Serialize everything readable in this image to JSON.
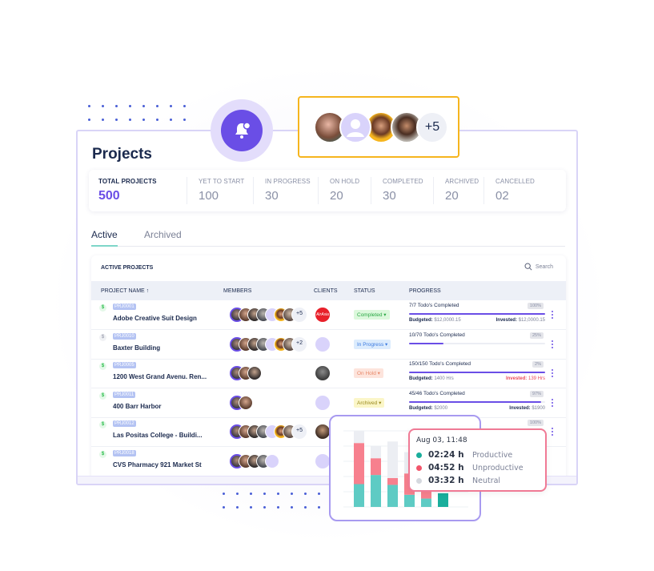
{
  "page": {
    "title": "Projects"
  },
  "stats": [
    {
      "label": "TOTAL PROJECTS",
      "value": "500"
    },
    {
      "label": "YET TO START",
      "value": "100"
    },
    {
      "label": "IN PROGRESS",
      "value": "30"
    },
    {
      "label": "ON HOLD",
      "value": "20"
    },
    {
      "label": "COMPLETED",
      "value": "30"
    },
    {
      "label": "ARCHIVED",
      "value": "20"
    },
    {
      "label": "CANCELLED",
      "value": "02"
    }
  ],
  "tabs": [
    {
      "label": "Active",
      "active": true
    },
    {
      "label": "Archived",
      "active": false
    }
  ],
  "table": {
    "title": "ACTIVE PROJECTS",
    "search_label": "Search",
    "columns": [
      "PROJECT NAME ↑",
      "MEMBERS",
      "CLIENTS",
      "STATUS",
      "PROGRESS"
    ],
    "rows": [
      {
        "id": "PRJ0001",
        "name": "Adobe Creative Suit Design",
        "billing": "paid",
        "members_extra": "+5",
        "member_count": 7,
        "client": "AirAsia",
        "client_type": "airasia",
        "status": "Completed",
        "status_type": "completed",
        "todos": "7/7 Todo's Completed",
        "percent": "100%",
        "progress": 1.0,
        "budget_label": "Budgeted:",
        "budget": "$12,0000.15",
        "invested_label": "Invested:",
        "invested": "$12,0000.15",
        "over": false
      },
      {
        "id": "PRJ0010",
        "name": "Baxter Building",
        "billing": "unpaid",
        "members_extra": "+2",
        "member_count": 7,
        "client": "",
        "client_type": "placeholder",
        "status": "In Progress",
        "status_type": "inprogress",
        "todos": "10/70 Todo's Completed",
        "percent": "25%",
        "progress": 0.25,
        "budget_label": "",
        "budget": "",
        "invested_label": "",
        "invested": "",
        "over": false
      },
      {
        "id": "PRJ0005",
        "name": "1200 West Grand Avenu. Ren...",
        "billing": "paid",
        "members_extra": "",
        "member_count": 3,
        "client": "",
        "client_type": "photo",
        "status": "On Hold",
        "status_type": "onhold",
        "todos": "150/150 Todo's Completed",
        "percent": "2%",
        "progress": 1.0,
        "budget_label": "Budgeted:",
        "budget": "1400 Hrs",
        "invested_label": "Invested:",
        "invested": "139 Hrs",
        "over": true
      },
      {
        "id": "PRJ0011",
        "name": "400 Barr Harbor",
        "billing": "paid",
        "members_extra": "",
        "member_count": 2,
        "client": "",
        "client_type": "placeholder",
        "status": "Archived",
        "status_type": "archived",
        "todos": "45/46 Todo's Completed",
        "percent": "97%",
        "progress": 0.97,
        "budget_label": "Budgeted:",
        "budget": "$2000",
        "invested_label": "Invested:",
        "invested": "$1900",
        "over": false
      },
      {
        "id": "PRJ0012",
        "name": "Las Positas College - Buildi...",
        "billing": "paid",
        "members_extra": "+5",
        "member_count": 7,
        "client": "",
        "client_type": "photo2",
        "status": "",
        "status_type": "",
        "todos": "",
        "percent": "100%",
        "progress": null,
        "budget_label": "",
        "budget": "",
        "invested_label": "",
        "invested": "",
        "over": false
      },
      {
        "id": "PRJ0018",
        "name": "CVS Pharmacy 921 Market St",
        "billing": "paid",
        "members_extra": "",
        "member_count": 5,
        "client": "",
        "client_type": "placeholder",
        "status": "",
        "status_type": "",
        "todos": "",
        "percent": "",
        "progress": null,
        "budget_label": "",
        "budget": "",
        "invested_label": "",
        "invested": "",
        "over": false
      }
    ]
  },
  "team": {
    "extra": "+5"
  },
  "activity_chart": {
    "series_colors": {
      "productive": "#5ecbc4",
      "unproductive": "#f7808e",
      "neutral": "#eceef3",
      "highlight": "#1aae9c"
    },
    "bars": [
      {
        "productive": 0.3,
        "unproductive": 0.54,
        "neutral": 0.16
      },
      {
        "productive": 0.42,
        "unproductive": 0.22,
        "neutral": 0.16
      },
      {
        "productive": 0.29,
        "unproductive": 0.09,
        "neutral": 0.48
      },
      {
        "productive": 0.16,
        "unproductive": 0.28,
        "neutral": 0.28
      },
      {
        "productive": 0.11,
        "unproductive": 0.14,
        "neutral": 0.0
      },
      {
        "productive": 0.18,
        "unproductive": 0.0,
        "neutral": 0.0,
        "highlight": true
      }
    ],
    "tooltip": {
      "title": "Aug 03, 11:48",
      "items": [
        {
          "value": "02:24 h",
          "label": "Productive",
          "color": "#1aae9c"
        },
        {
          "value": "04:52 h",
          "label": "Unproductive",
          "color": "#f2556b"
        },
        {
          "value": "03:32 h",
          "label": "Neutral",
          "color": "#d5d8de"
        }
      ]
    }
  }
}
